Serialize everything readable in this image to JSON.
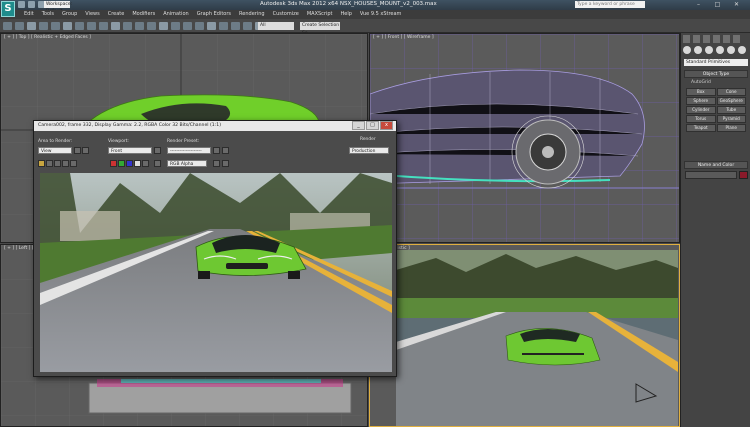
{
  "app": {
    "logo_letter": "S",
    "title": "Autodesk 3ds Max 2012 x64      NSX_HOUSES_MOUNT_v2_003.max",
    "workspace": "Workspace: Default",
    "search_placeholder": "Type a keyword or phrase",
    "controls": [
      "–",
      "□",
      "✕"
    ]
  },
  "menu": [
    "Edit",
    "Tools",
    "Group",
    "Views",
    "Create",
    "Modifiers",
    "Animation",
    "Graph Editors",
    "Rendering",
    "Customize",
    "MAXScript",
    "Help",
    "Vue 9.5 xStream"
  ],
  "toolbar": {
    "selection_filter": "All",
    "named_selection": "Create Selection Se"
  },
  "viewports": {
    "top_label": "[ + ] [ Top ] [ Realistic + Edged Faces ]",
    "front_label": "[ + ] [ Front ] [ Wireframe ]",
    "left_label": "[ + ] [ Left ] [ Wireframe ]",
    "persp_label": "[ + ] [ Realistic ]"
  },
  "command_panel": {
    "category": "Standard Primitives",
    "object_type_header": "Object Type",
    "autogrid_label": "AutoGrid",
    "primitives": [
      "Box",
      "Cone",
      "Sphere",
      "GeoSphere",
      "Cylinder",
      "Tube",
      "Torus",
      "Pyramid",
      "Teapot",
      "Plane"
    ],
    "name_color_header": "Name and Color",
    "object_color": "#8a1a2a"
  },
  "render_window": {
    "title": "Camera002, frame 332, Display Gamma: 2.2, RGBA Color 32 Bits/Channel (1:1)",
    "area_label": "Area to Render:",
    "area_value": "View",
    "viewport_label": "Viewport:",
    "viewport_value": "Front",
    "preset_label": "Render Preset:",
    "preset_value": "--------------------",
    "render_label": "Render",
    "production_value": "Production",
    "channel_value": "RGB Alpha"
  },
  "colors": {
    "car_green": "#6ec832",
    "wire_purple": "#8a7fd0",
    "road_gray": "#7d7f84",
    "accent_yellow": "#e7b23a"
  }
}
